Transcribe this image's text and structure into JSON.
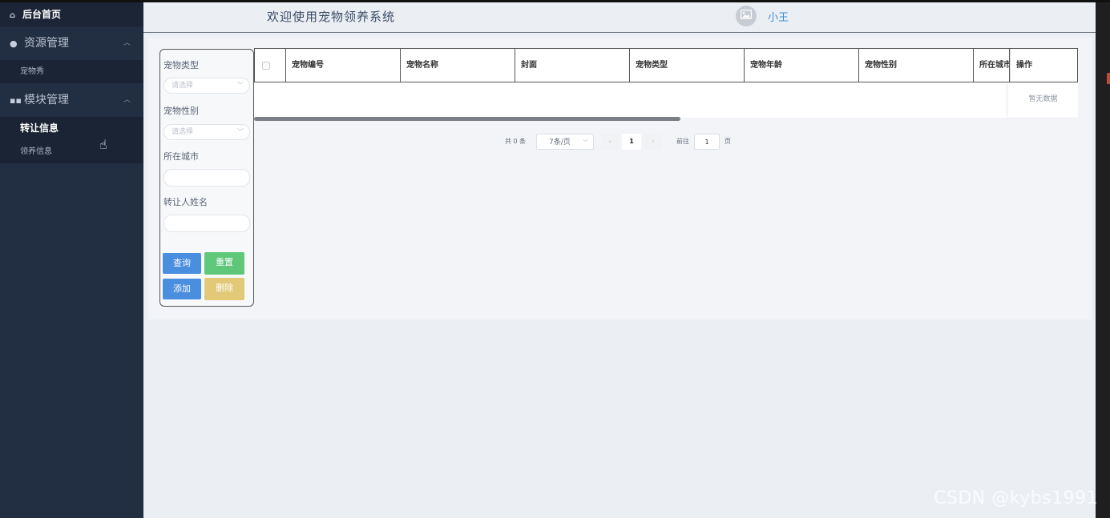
{
  "sidebar": {
    "home_label": "后台首页",
    "groups": [
      {
        "label": "资源管理",
        "icon": "location-pin-icon",
        "items": [
          {
            "label": "宠物秀"
          }
        ]
      },
      {
        "label": "模块管理",
        "icon": "grid-icon",
        "items": [
          {
            "label": "转让信息",
            "active": true
          },
          {
            "label": "领养信息"
          }
        ]
      }
    ]
  },
  "header": {
    "title": "欢迎使用宠物领养系统",
    "username": "小王"
  },
  "filter": {
    "pet_type_label": "宠物类型",
    "pet_type_placeholder": "请选择",
    "pet_gender_label": "宠物性别",
    "pet_gender_placeholder": "请选择",
    "city_label": "所在城市",
    "transferor_label": "转让人姓名",
    "query_label": "查询",
    "reset_label": "重置",
    "add_label": "添加",
    "delete_label": "删除"
  },
  "table": {
    "columns": [
      "宠物编号",
      "宠物名称",
      "封面",
      "宠物类型",
      "宠物年龄",
      "宠物性别",
      "所在城市",
      "操作"
    ],
    "empty_text": "暂无数据"
  },
  "pagination": {
    "total_text": "共 0 条",
    "page_size": "7条/页",
    "current_page": "1",
    "goto_prefix": "前往",
    "goto_value": "1",
    "goto_suffix": "页"
  },
  "watermark": "CSDN @kybs1991",
  "colors": {
    "sidebar_bg": "#222e42",
    "primary": "#4a8ee0",
    "success": "#5fc779",
    "warning": "#e2c978",
    "username": "#3d8fd6"
  }
}
